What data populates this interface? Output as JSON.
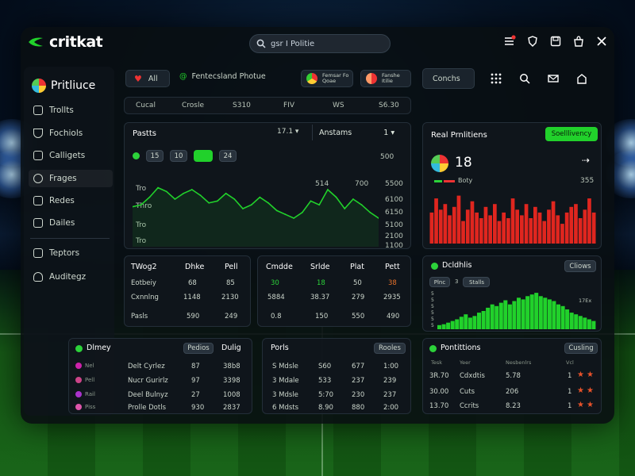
{
  "app": {
    "name": "critkat",
    "brand_color": "#21d12b"
  },
  "search": {
    "value": "gsr I Politie"
  },
  "top_icons": [
    "list-icon",
    "shield-icon",
    "save-icon",
    "bag-icon",
    "close-icon"
  ],
  "sidebar": {
    "title": "Pritliuce",
    "items": [
      {
        "label": "Trollts",
        "icon": "home-icon"
      },
      {
        "label": "Fochiols",
        "icon": "trophy-icon"
      },
      {
        "label": "Calligets",
        "icon": "cart-icon"
      },
      {
        "label": "Frages",
        "icon": "ball-icon"
      },
      {
        "label": "Redes",
        "icon": "users-icon"
      },
      {
        "label": "Dailes",
        "icon": "chat-icon"
      }
    ],
    "items2": [
      {
        "label": "Teptors",
        "icon": "doc-icon"
      },
      {
        "label": "Auditegz",
        "icon": "headset-icon"
      }
    ]
  },
  "filters": {
    "all": "All",
    "fav": "Fentecsland Photue",
    "team1": {
      "name": "Femsar Fo",
      "sub": "Qoae"
    },
    "team2": {
      "name": "Fanshe",
      "sub": "Itilie"
    },
    "controls": "Conchs"
  },
  "stats_bar": [
    "Cucal",
    "Crosle",
    "S310",
    "FIV",
    "WS",
    "S6.30"
  ],
  "chart1": {
    "title": "Pastts",
    "select": "17.1",
    "select2_label": "Anstams",
    "select2_value": "1",
    "chips": [
      "15",
      "10",
      "",
      "24"
    ],
    "ylabels_left": [
      "Tro",
      "Thro",
      "Tro",
      "Tro",
      "500"
    ],
    "peak_labels": [
      "514",
      "700"
    ],
    "ylabels_right": [
      "5500",
      "6100",
      "6150",
      "5100",
      "2100",
      "1100"
    ]
  },
  "chart_data": [
    {
      "type": "line",
      "title": "Pastts",
      "x": [
        0,
        1,
        2,
        3,
        4,
        5,
        6,
        7,
        8,
        9,
        10,
        11,
        12,
        13,
        14,
        15,
        16,
        17,
        18,
        19,
        20,
        21,
        22,
        23,
        24,
        25,
        26,
        27,
        28,
        29
      ],
      "series": [
        {
          "values": [
            42,
            44,
            52,
            62,
            58,
            50,
            56,
            60,
            54,
            46,
            48,
            56,
            50,
            40,
            44,
            52,
            46,
            38,
            34,
            30,
            36,
            48,
            44,
            60,
            52,
            40,
            50,
            44,
            36,
            30
          ]
        }
      ]
    },
    {
      "type": "bar",
      "title": "Real Prnlitiens",
      "series": [
        {
          "values": [
            55,
            80,
            60,
            70,
            50,
            65,
            85,
            40,
            60,
            75,
            55,
            45,
            65,
            50,
            70,
            40,
            55,
            45,
            80,
            60,
            50,
            70,
            45,
            65,
            55,
            40,
            60,
            75,
            50,
            35,
            55,
            65,
            70,
            45,
            60,
            80,
            55
          ]
        }
      ]
    },
    {
      "type": "area",
      "title": "Dcldhlis",
      "series": [
        {
          "values": [
            5,
            6,
            8,
            10,
            12,
            15,
            18,
            14,
            16,
            20,
            22,
            26,
            30,
            28,
            32,
            35,
            30,
            34,
            38,
            36,
            40,
            42,
            44,
            40,
            38,
            36,
            34,
            30,
            28,
            24,
            20,
            18,
            16,
            14,
            12,
            10
          ]
        }
      ]
    }
  ],
  "real_prediction": {
    "title": "Real Prnlitiens",
    "button": "Soelllivency",
    "value": "18",
    "label": "Boty",
    "score": "355"
  },
  "table1": {
    "headers": [
      "TWog2",
      "Dhke",
      "Pell"
    ],
    "rows": [
      [
        "Eotbeiy",
        "68",
        "85"
      ],
      [
        "Cxnnlng",
        "1148",
        "2130"
      ],
      [
        "Pasls",
        "590",
        "249"
      ]
    ]
  },
  "table2": {
    "headers": [
      "Cmdde",
      "Srlde",
      "Plat",
      "Pett"
    ],
    "rows": [
      [
        "30",
        "18",
        "50",
        "38"
      ],
      [
        "5884",
        "38.37",
        "279",
        "2935"
      ],
      [
        "0.8",
        "150",
        "550",
        "490"
      ]
    ]
  },
  "depth_chart": {
    "title": "Dcldhlis",
    "btn": "Cliows",
    "tabs": [
      "Plnc",
      "3",
      "Stalls"
    ],
    "ylabels": [
      "5",
      "5",
      "5",
      "5",
      "5",
      "5"
    ],
    "right_label": "17Ex"
  },
  "dlmey": {
    "title": "Dlmey",
    "btn": "Pedios",
    "col": "Dulig",
    "rows": [
      [
        "Nel",
        "Delt Cyrlez",
        "87",
        "38b8"
      ],
      [
        "Pell",
        "Nucr Gurirlz",
        "97",
        "3398"
      ],
      [
        "Rail",
        "Deel Bulnyz",
        "27",
        "1008"
      ],
      [
        "Piss",
        "Prolle Dotls",
        "930",
        "2837"
      ]
    ]
  },
  "porls": {
    "title": "Porls",
    "btn": "Rooles",
    "rows": [
      [
        "S Mdsle",
        "S60",
        "677",
        "1:00"
      ],
      [
        "3 Mdale",
        "533",
        "237",
        "239"
      ],
      [
        "3 Mdsle",
        "5:70",
        "230",
        "237"
      ],
      [
        "6 Mdsts",
        "8.90",
        "880",
        "2:00"
      ]
    ]
  },
  "positions": {
    "title": "Pontittions",
    "btn": "Cusling",
    "headers": [
      "Tesk",
      "Yeer",
      "Nesbenlrs",
      "Vcl"
    ],
    "rows": [
      [
        "3R.70",
        "Cdxdtis",
        "5.78",
        "1"
      ],
      [
        "30.00",
        "Cuts",
        "206",
        "1"
      ],
      [
        "13.70",
        "Ccrits",
        "8.23",
        "1"
      ]
    ]
  }
}
